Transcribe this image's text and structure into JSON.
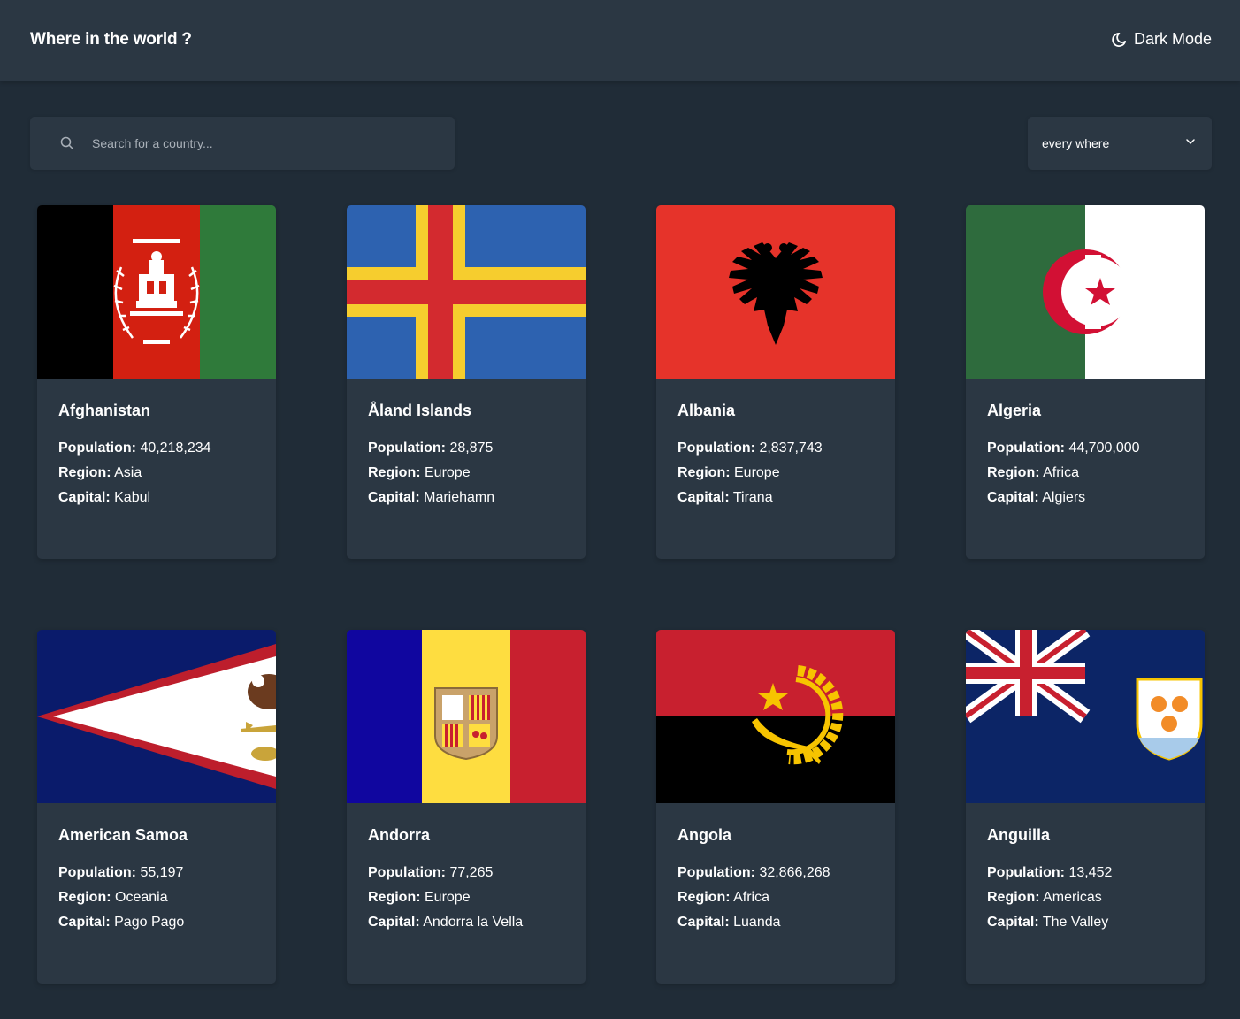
{
  "header": {
    "title": "Where in the world ?",
    "theme_toggle": {
      "label": "Dark Mode",
      "icon": "moon-icon"
    }
  },
  "search": {
    "placeholder": "Search for a country...",
    "value": "",
    "icon": "search-icon"
  },
  "filter": {
    "selected": "every where",
    "icon": "chevron-down-icon"
  },
  "labels": {
    "population": "Population:",
    "region": "Region:",
    "capital": "Capital:"
  },
  "countries": [
    {
      "name": "Afghanistan",
      "population": "40,218,234",
      "region": "Asia",
      "capital": "Kabul",
      "flag": "afghanistan-flag"
    },
    {
      "name": "Åland Islands",
      "population": "28,875",
      "region": "Europe",
      "capital": "Mariehamn",
      "flag": "aland-islands-flag"
    },
    {
      "name": "Albania",
      "population": "2,837,743",
      "region": "Europe",
      "capital": "Tirana",
      "flag": "albania-flag"
    },
    {
      "name": "Algeria",
      "population": "44,700,000",
      "region": "Africa",
      "capital": "Algiers",
      "flag": "algeria-flag"
    },
    {
      "name": "American Samoa",
      "population": "55,197",
      "region": "Oceania",
      "capital": "Pago Pago",
      "flag": "american-samoa-flag"
    },
    {
      "name": "Andorra",
      "population": "77,265",
      "region": "Europe",
      "capital": "Andorra la Vella",
      "flag": "andorra-flag"
    },
    {
      "name": "Angola",
      "population": "32,866,268",
      "region": "Africa",
      "capital": "Luanda",
      "flag": "angola-flag"
    },
    {
      "name": "Anguilla",
      "population": "13,452",
      "region": "Americas",
      "capital": "The Valley",
      "flag": "anguilla-flag"
    }
  ],
  "colors": {
    "background": "#202c37",
    "element": "#2b3743",
    "text": "#ffffff",
    "placeholder": "#a9b0b8"
  }
}
